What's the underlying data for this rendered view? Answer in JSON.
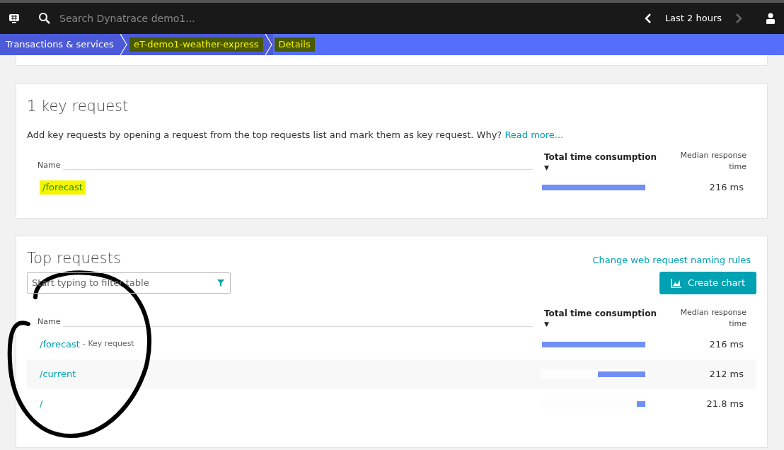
{
  "topbar": {
    "search_placeholder": "Search Dynatrace demo1...",
    "timeframe": "Last 2 hours"
  },
  "breadcrumb": [
    {
      "label": "Transactions & services",
      "highlighted": false
    },
    {
      "label": "eT-demo1-weather-express",
      "highlighted": true
    },
    {
      "label": "Details",
      "highlighted": true
    }
  ],
  "key_requests": {
    "title": "1 key request",
    "description": "Add key requests by opening a request from the top requests list and mark them as key request. Why?",
    "link": "Read more...",
    "columns": [
      "Name",
      "Total time consumption",
      "▼",
      "Median response time"
    ],
    "rows": [
      {
        "name": "/forecast",
        "highlighted": true,
        "level": 1,
        "time": "216 ms"
      }
    ]
  },
  "top_requests": {
    "title": "Top requests",
    "link": "Change web request naming rules",
    "filter_placeholder": "Start typing to filter table",
    "button": "Create chart",
    "columns": [
      "Name",
      "Total time consumption",
      "▼",
      "Median response time"
    ],
    "rows": [
      {
        "name": "/forecast",
        "note": "- Key request",
        "highlighted": false,
        "level": 1,
        "time": "216 ms"
      },
      {
        "name": "/current",
        "highlighted": false,
        "level": 0.46,
        "time": "212 ms"
      },
      {
        "name": "/",
        "highlighted": false,
        "level": 0.08,
        "time": "21.8 ms"
      }
    ]
  }
}
